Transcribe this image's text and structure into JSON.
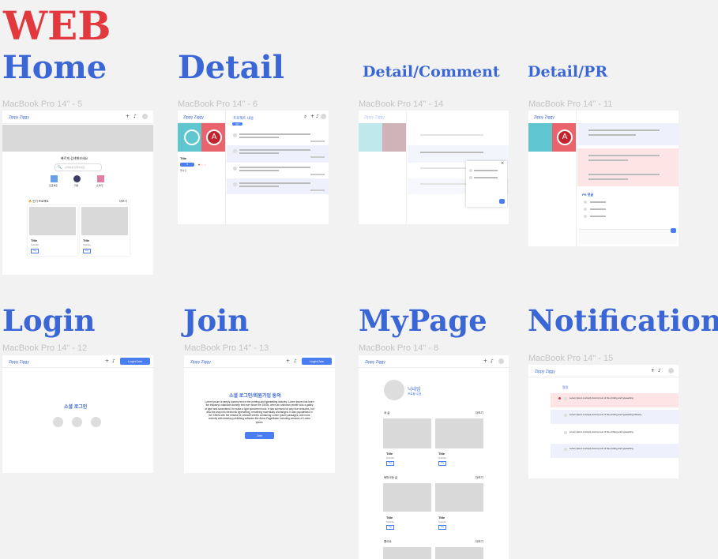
{
  "canvas": {
    "web_label": "WEB",
    "headings": {
      "home": "Home",
      "detail": "Detail",
      "detail_comment": "Detail/Comment",
      "detail_pr": "Detail/PR",
      "login": "Login",
      "join": "Join",
      "mypage": "MyPage",
      "notification": "Notification"
    },
    "captions": {
      "home": "MacBook Pro 14\" - 5",
      "detail": "MacBook Pro 14\" - 6",
      "detail_comment": "MacBook Pro 14\" - 14",
      "detail_pr": "MacBook Pro 14\" - 11",
      "login": "MacBook Pro 14\" - 12",
      "join": "MacBook Pro 14\" - 13",
      "mypage": "MacBook Pro 14\" - 8",
      "notification": "MacBook Pro 14\" - 15"
    }
  },
  "app": {
    "logo": "Zippy Ziggy",
    "header_icons": [
      "+",
      "bell-icon",
      "avatar"
    ],
    "login_join_button": "Login/Join"
  },
  "home": {
    "title_text": "빠르게 검색해보세요",
    "search_placeholder": "검색어를 입력하세요",
    "categories": [
      "프로젝트",
      "자유",
      "스터디"
    ],
    "section_title": "🔥 인기 프로젝트",
    "more": "더보기",
    "card_title": "Title",
    "card_sub": "Subtitle",
    "card_btn": "Tag"
  },
  "detail": {
    "title": "Title",
    "like": "좋아요",
    "tab": "프로젝트 내용",
    "badge": "댓글"
  },
  "login": {
    "title": "소셜 로그인"
  },
  "join": {
    "title": "소셜 로그인/회원가입 동의",
    "body": "Lorem Ipsum is simply dummy text of the printing and typesetting industry. Lorem Ipsum has been the industry's standard dummy text ever since the 1500s, when an unknown printer took a galley of type and scrambled it to make a type specimen book. It has survived not only five centuries, but also the leap into electronic typesetting, remaining essentially unchanged. It was popularised in the 1960s with the release of Letraset sheets containing Lorem Ipsum passages, and more recently with desktop publishing software like Aldus PageMaker including versions of Lorem Ipsum.",
    "button": "Join"
  },
  "mypage": {
    "nickname": "닉네임",
    "edit": "프로필 수정",
    "section1": "내 글",
    "section2": "북마크한 글",
    "section3": "좋아요",
    "more": "더보기",
    "card_title": "Title",
    "card_sub": "Subtitle",
    "card_btn": "Tag"
  },
  "notification": {
    "section": "알림",
    "items": [
      "Lorem Ipsum is simply dummy text of the printing and typesetting.",
      "Lorem Ipsum is simply dummy text of the printing and typesetting industry.",
      "Lorem Ipsum is simply dummy text of the printing and typesetting.",
      "Lorem Ipsum is simply dummy text of the printing and typesetting."
    ]
  },
  "detail_pr": {
    "section": "PR 댓글"
  }
}
